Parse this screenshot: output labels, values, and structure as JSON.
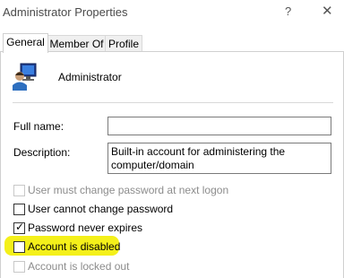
{
  "window": {
    "title": "Administrator Properties",
    "help_glyph": "?",
    "close_glyph": "✕"
  },
  "tabs": [
    {
      "label": "General",
      "active": true
    },
    {
      "label": "Member Of",
      "active": false
    },
    {
      "label": "Profile",
      "active": false
    }
  ],
  "user": {
    "name": "Administrator",
    "icon": "user-computer-icon"
  },
  "fields": {
    "full_name": {
      "label": "Full name:",
      "value": ""
    },
    "description": {
      "label": "Description:",
      "value": "Built-in account for administering the\ncomputer/domain"
    }
  },
  "checkboxes": [
    {
      "label": "User must change password at next logon",
      "checked": false,
      "disabled": true
    },
    {
      "label": "User cannot change password",
      "checked": false,
      "disabled": false
    },
    {
      "label": "Password never expires",
      "checked": true,
      "disabled": false
    },
    {
      "label": "Account is disabled",
      "checked": false,
      "disabled": false
    },
    {
      "label": "Account is locked out",
      "checked": false,
      "disabled": true
    }
  ],
  "colors": {
    "highlight": "#f4f01a",
    "disabled_text": "#8c8c8c"
  }
}
